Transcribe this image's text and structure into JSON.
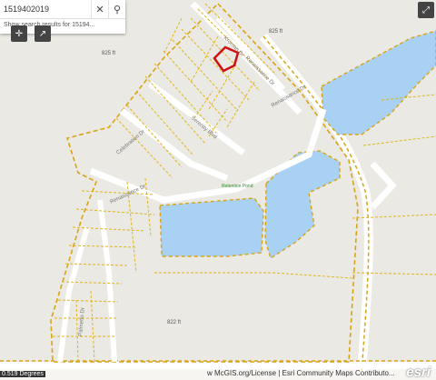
{
  "search": {
    "value": "1519402019",
    "suggestion": "Show search results for 15194..."
  },
  "icons": {
    "clear": "close-icon",
    "search": "search-icon",
    "expand": "expand-icon"
  },
  "map": {
    "streets": [
      "Kroman Dr",
      "Renaissance Dr",
      "Renaissance Dr",
      "Celebration Dr",
      "Serenity Blvd",
      "Renaissance Dr",
      "Palmetto Dr"
    ],
    "elevations": [
      "825 ft",
      "825 ft",
      "822 ft"
    ],
    "water_label": "Retention Pond"
  },
  "attribution": "w McGIS.org/License | Esri Community Maps Contributo...",
  "scale_label": "0.519 Degrees",
  "esri": "esri",
  "colors": {
    "water": "#a9d1f3",
    "parcel": "#e0b61c",
    "road": "#ffffff",
    "bg": "#ebe9e3",
    "highlight": "#cc1111"
  }
}
